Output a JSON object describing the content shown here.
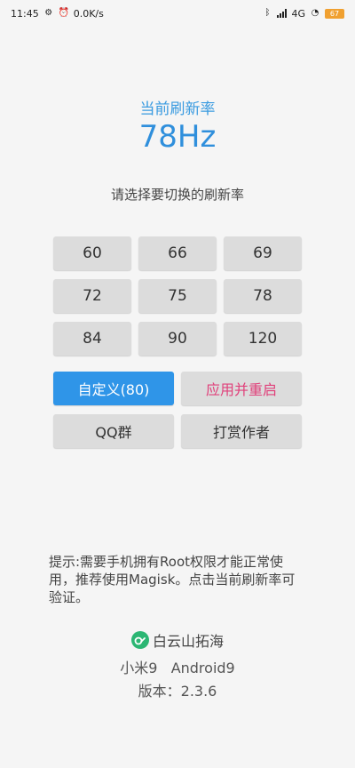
{
  "statusbar": {
    "time": "11:45",
    "speed": "0.0K/s",
    "network": "4G",
    "battery": "67"
  },
  "header": {
    "title": "当前刷新率",
    "current_rate": "78Hz"
  },
  "prompt": "请选择要切换的刷新率",
  "rates": [
    "60",
    "66",
    "69",
    "72",
    "75",
    "78",
    "84",
    "90",
    "120"
  ],
  "actions": {
    "custom": "自定义(80)",
    "apply": "应用并重启",
    "qq_group": "QQ群",
    "donate": "打赏作者"
  },
  "hint": "提示:需要手机拥有Root权限才能正常使用，推荐使用Magisk。点击当前刷新率可验证。",
  "footer": {
    "author": "白云山拓海",
    "device": "小米9   Android9",
    "version": "版本：2.3.6"
  },
  "colors": {
    "accent_blue": "#2f95e8",
    "apply_pink": "#e0407a",
    "logo_green": "#2bb673"
  }
}
